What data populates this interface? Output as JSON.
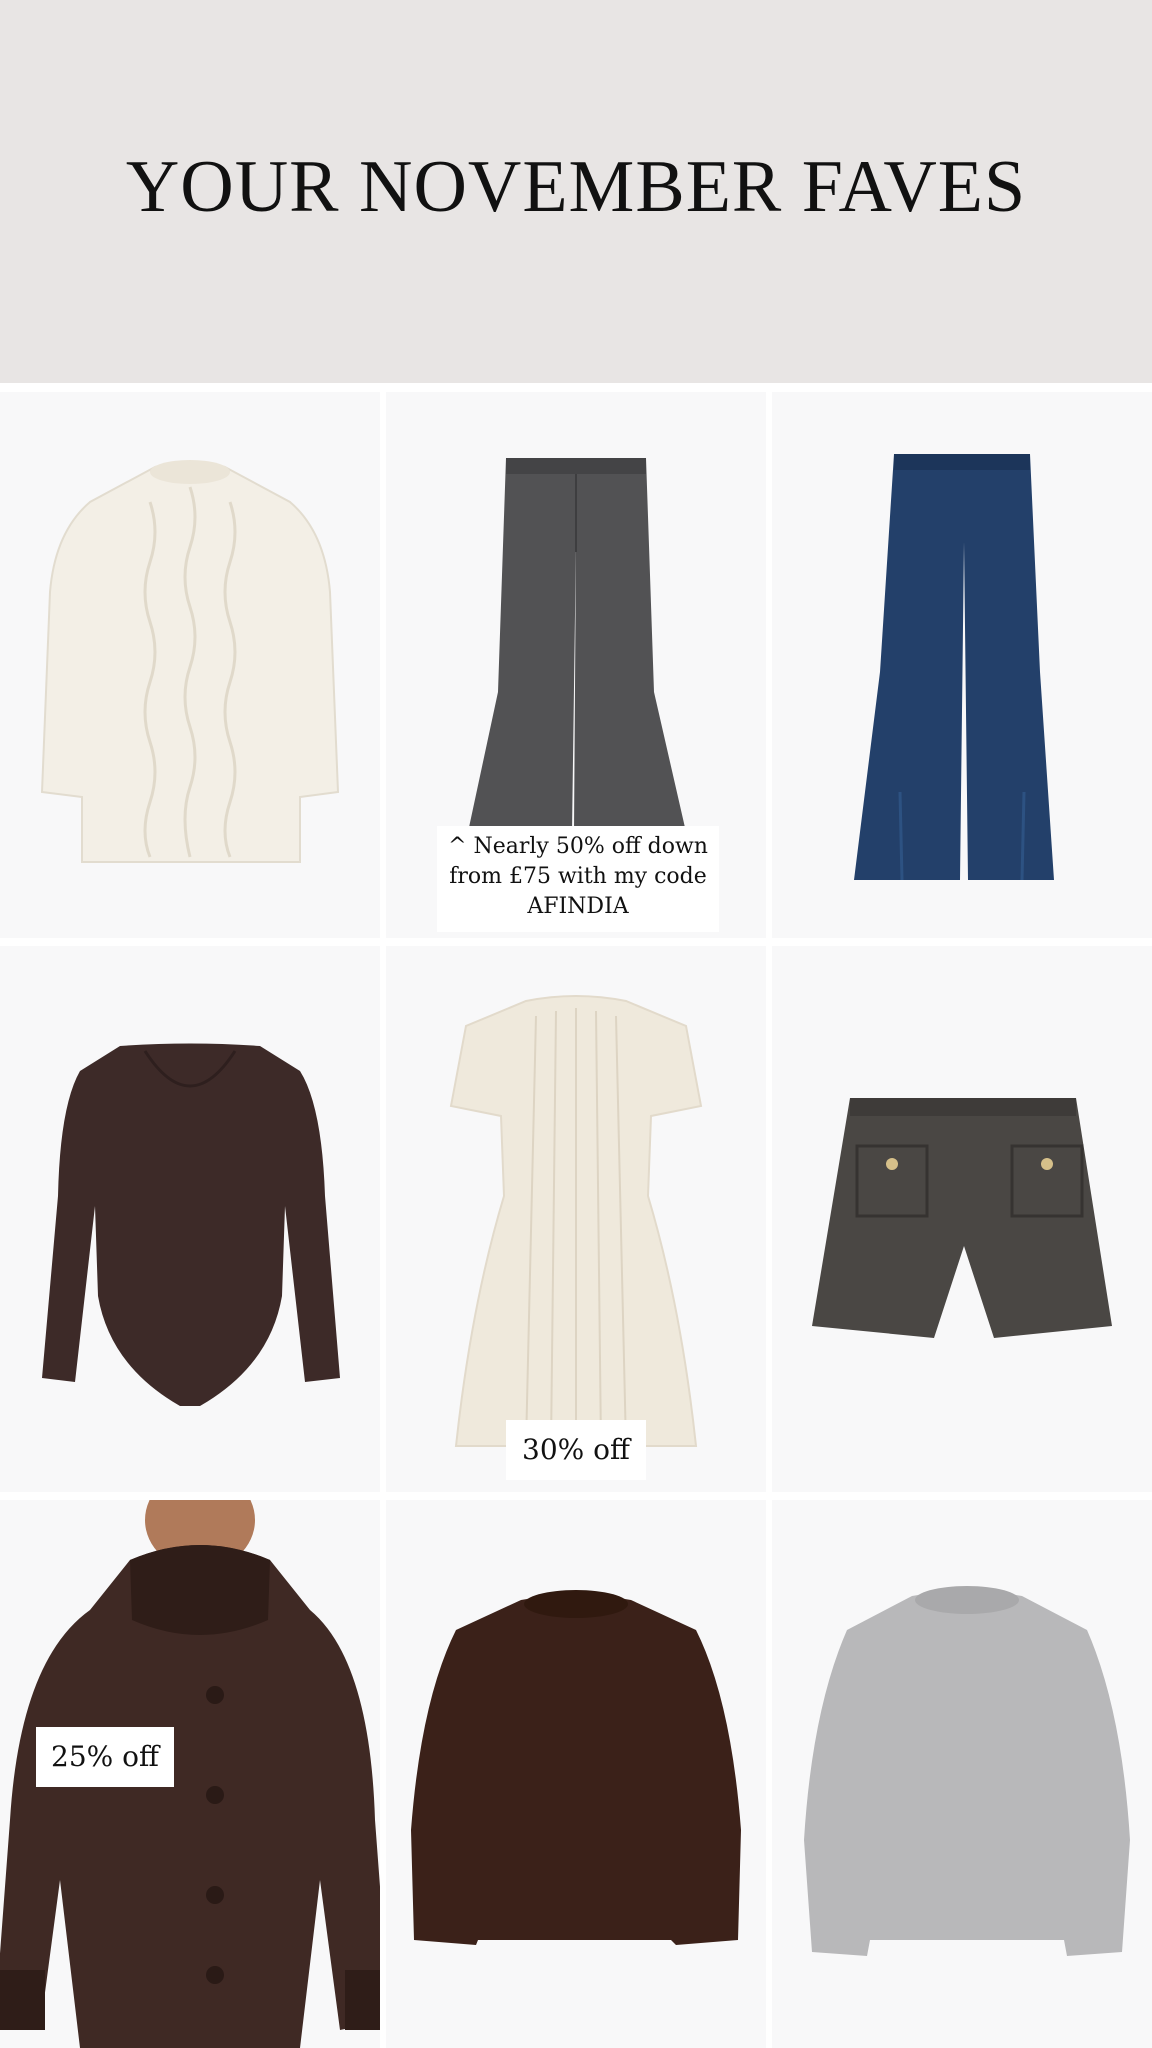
{
  "header": {
    "title": "YOUR NOVEMBER FAVES"
  },
  "products": [
    {
      "name": "cream cable-knit sweater dress",
      "color": "#f3efe6"
    },
    {
      "name": "grey wide-leg jeans",
      "color": "#505052"
    },
    {
      "name": "dark blue straight jeans",
      "color": "#233e66"
    },
    {
      "name": "brown long-sleeve bodysuit",
      "color": "#3d2a28"
    },
    {
      "name": "cream ribbed knit mini dress",
      "color": "#efe9dc"
    },
    {
      "name": "grey tweed check shorts",
      "color": "#4a4744"
    },
    {
      "name": "brown shearling jacket",
      "color": "#3f2924"
    },
    {
      "name": "brown fluffy crew sweater",
      "color": "#3b2119"
    },
    {
      "name": "light grey fluffy crew sweater",
      "color": "#b8b8ba"
    }
  ],
  "badges": {
    "jeans_offer": "^ Nearly 50% off down from £75 with my code AFINDIA",
    "dress_offer": "30% off",
    "jacket_offer": "25% off"
  }
}
